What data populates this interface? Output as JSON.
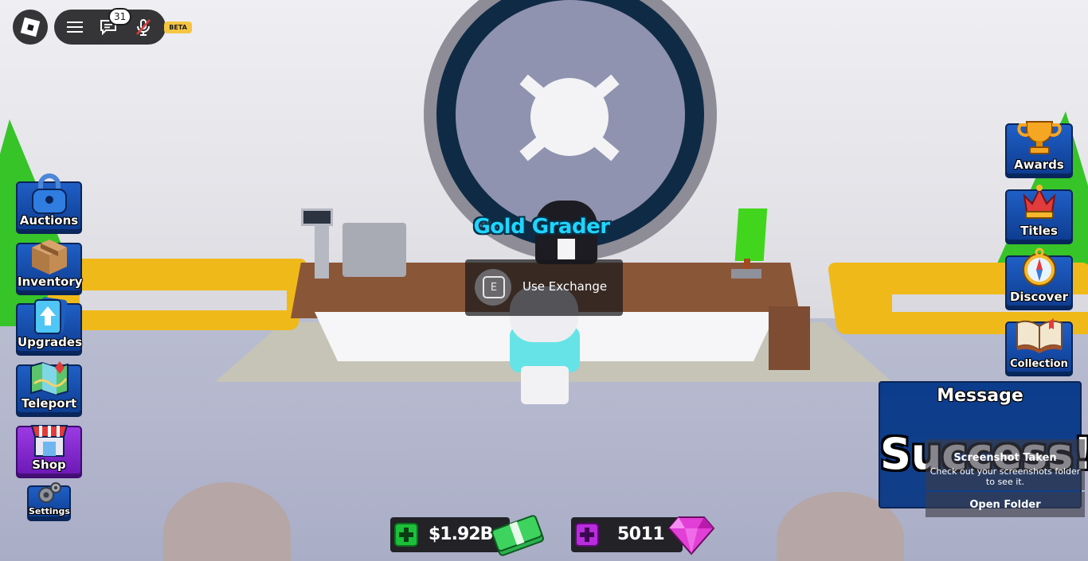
{
  "topbar": {
    "chat_unread": "31",
    "beta_label": "BETA",
    "icons": [
      "roblox-logo-icon",
      "menu-icon",
      "chat-icon",
      "mic-muted-icon"
    ]
  },
  "left_menu": {
    "auctions": "Auctions",
    "inventory": "Inventory",
    "upgrades": "Upgrades",
    "teleport": "Teleport",
    "shop": "Shop",
    "settings": "Settings"
  },
  "right_menu": {
    "awards": "Awards",
    "titles": "Titles",
    "discover": "Discover",
    "collection": "Collection"
  },
  "npc": {
    "name": "Gold Grader"
  },
  "prompt": {
    "key": "E",
    "action": "Use Exchange"
  },
  "message": {
    "title": "Message",
    "body": "Success!"
  },
  "screenshot_toast": {
    "title": "Screenshot Taken",
    "description": "Check out your screenshots folder to see it.",
    "button": "Open Folder"
  },
  "currency": {
    "cash": "$1.92B",
    "gems": "5011"
  },
  "colors": {
    "menu_blue": "#1f5fc6",
    "shop_purple": "#9b3be3",
    "npc_name": "#1fd5ff",
    "cash_green": "#1cbf3a",
    "gem_purple": "#b72ddb"
  }
}
